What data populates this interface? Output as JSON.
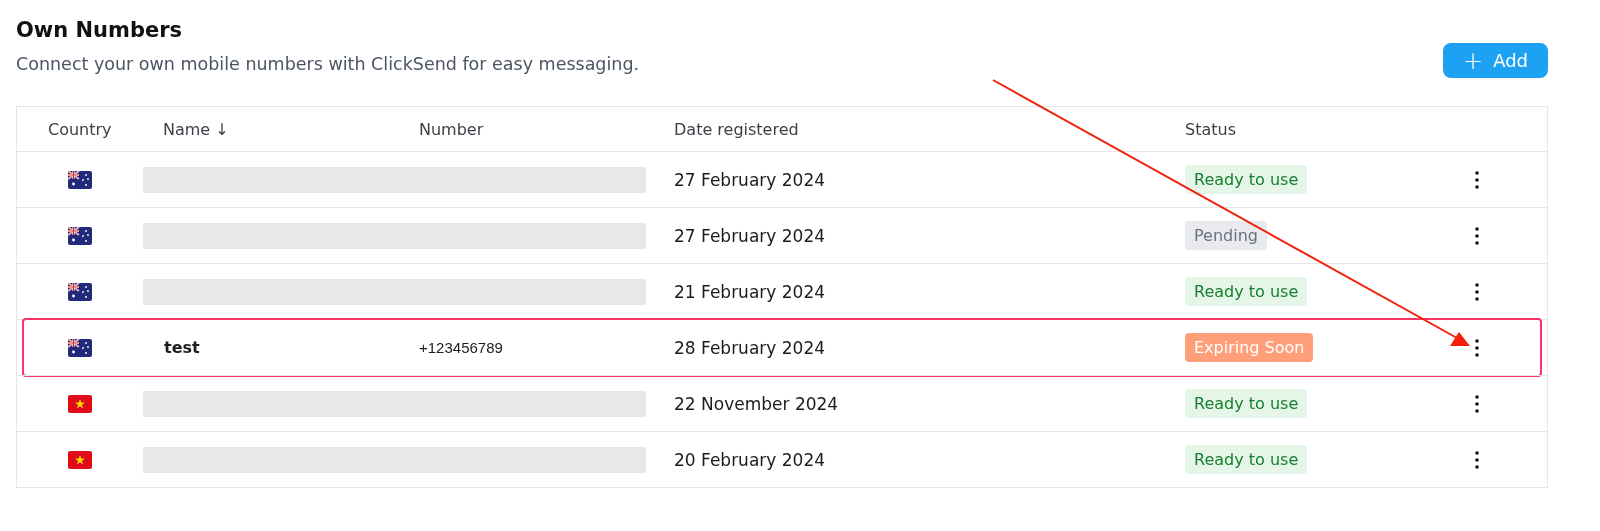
{
  "header": {
    "title": "Own Numbers",
    "subtitle": "Connect your own mobile numbers with ClickSend for easy messaging.",
    "add_button": {
      "icon": "+",
      "label": "Add"
    }
  },
  "table": {
    "columns": [
      {
        "label": "Country"
      },
      {
        "label": "Name",
        "sort_indicator": "↓"
      },
      {
        "label": "Number"
      },
      {
        "label": "Date registered"
      },
      {
        "label": "Status"
      }
    ],
    "rows": [
      {
        "country_flag": {
          "kind": "au"
        },
        "kind": "redacted",
        "date": "27 February 2024",
        "status": {
          "label": "Ready to use",
          "kind": "success"
        },
        "highlighted": false
      },
      {
        "country_flag": {
          "kind": "au"
        },
        "kind": "redacted",
        "date": "27 February 2024",
        "status": {
          "label": "Pending",
          "kind": "neutral"
        },
        "highlighted": false
      },
      {
        "country_flag": {
          "kind": "au"
        },
        "kind": "redacted",
        "date": "21 February 2024",
        "status": {
          "label": "Ready to use",
          "kind": "success"
        },
        "highlighted": false
      },
      {
        "country_flag": {
          "kind": "au"
        },
        "kind": "plain",
        "name": "test",
        "number": "+123456789",
        "date": "28 February 2024",
        "status": {
          "label": "Expiring Soon",
          "kind": "warning"
        },
        "highlighted": true
      },
      {
        "country_flag": {
          "kind": "vn"
        },
        "kind": "redacted",
        "date": "22 November 2024",
        "status": {
          "label": "Ready to use",
          "kind": "success"
        },
        "highlighted": false
      },
      {
        "country_flag": {
          "kind": "vn"
        },
        "kind": "redacted",
        "date": "20 February 2024",
        "status": {
          "label": "Ready to use",
          "kind": "success"
        },
        "highlighted": false
      }
    ]
  }
}
